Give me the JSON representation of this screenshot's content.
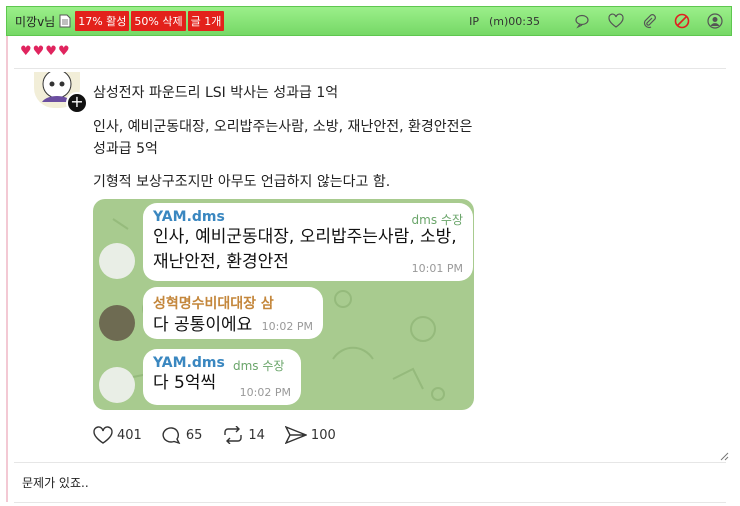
{
  "topbar": {
    "nickname": "미깡v님",
    "badges": [
      "17% 활성",
      "50% 삭제",
      "글 1개"
    ],
    "ip_label": "IP",
    "time": "(m)00:35",
    "icons": [
      "chat-icon",
      "heart-icon",
      "attach-icon",
      "block-icon",
      "user-icon"
    ]
  },
  "hearts": "♥♥♥♥",
  "post": {
    "line1": "삼성전자 파운드리 LSI 박사는 성과급 1억",
    "line2a": "인사, 예비군동대장, 오리밥주는사람, 소방, 재난안전, 환경안전은",
    "line2b": "성과급 5억",
    "line3": "기형적 보상구조지만 아무도 언급하지 않는다고 함."
  },
  "telegram": {
    "messages": [
      {
        "sender": "YAM.dms",
        "tag": "dms 수장",
        "text1": "인사, 예비군동대장, 오리밥주는사람, 소방,",
        "text2": "재난안전, 환경안전",
        "time": "10:01 PM"
      },
      {
        "sender": "성혁명수비대대장 삼",
        "text1": "다 공통이에요",
        "time": "10:02 PM"
      },
      {
        "sender": "YAM.dms",
        "tag": "dms 수장",
        "text1": "다 5억씩",
        "time": "10:02 PM"
      }
    ]
  },
  "actions": {
    "likes": "401",
    "comments": "65",
    "reposts": "14",
    "shares": "100"
  },
  "comment": "문제가 있죠.."
}
